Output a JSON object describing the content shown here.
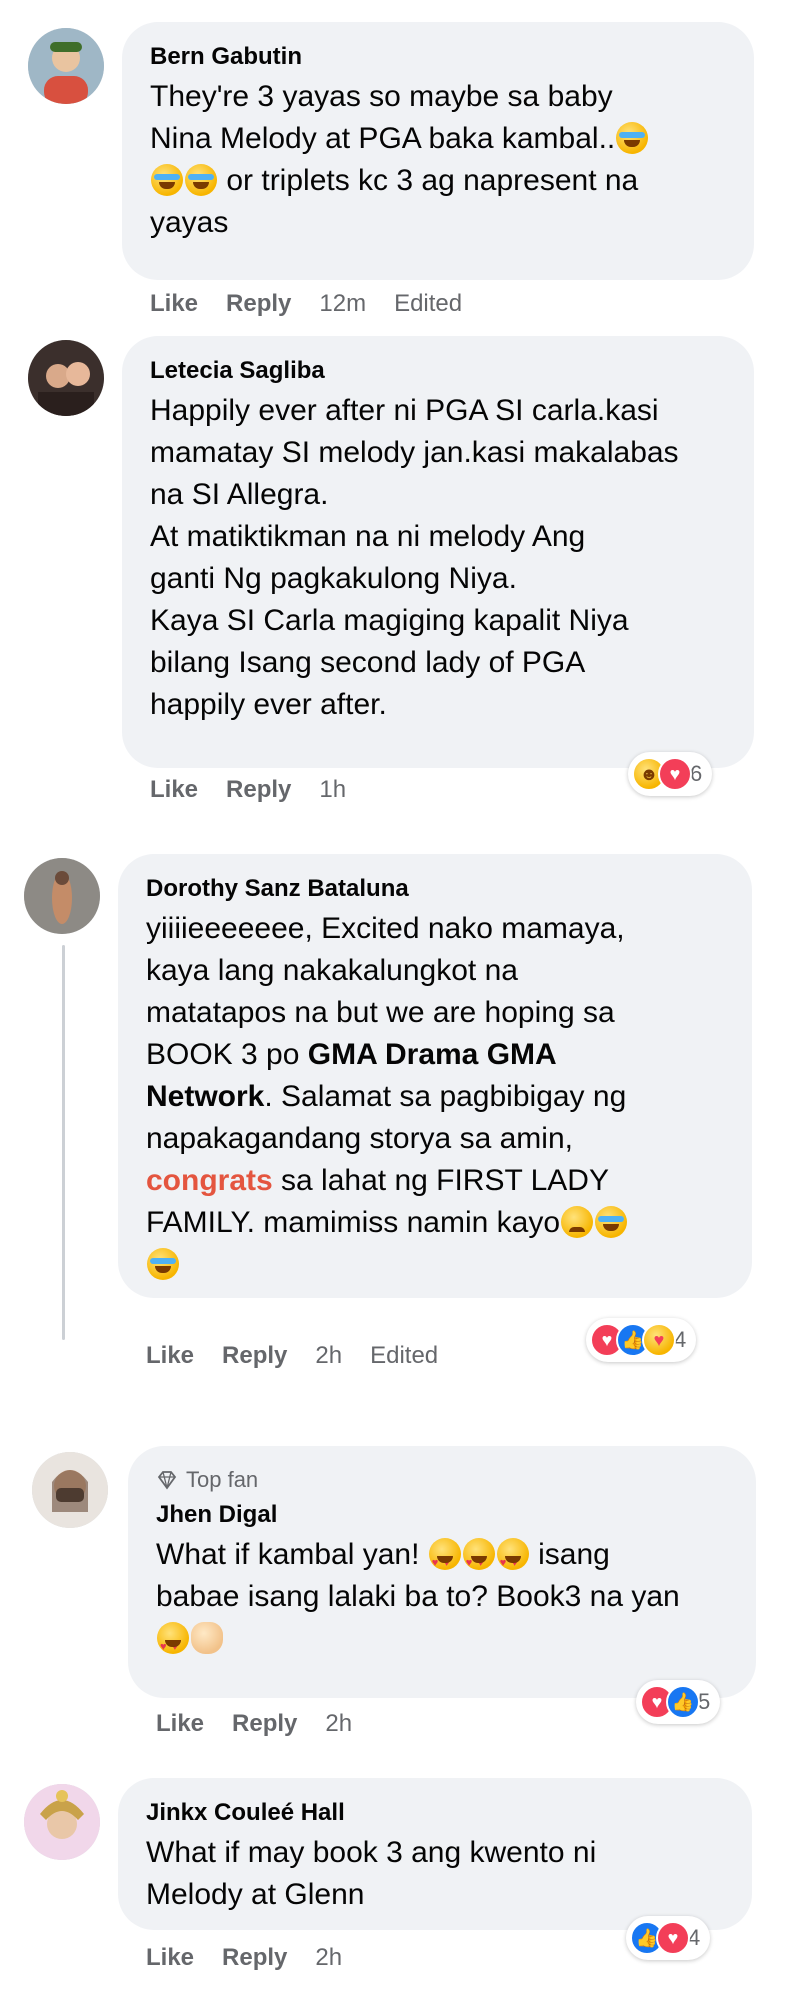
{
  "accent": "#e4553f",
  "comments": [
    {
      "author": "Bern Gabutin",
      "lines": [
        "They're 3 yayas so maybe sa baby",
        "Nina Melody at PGA baka kambal..",
        "or triplets kc 3 ag napresent na",
        "yayas"
      ],
      "emoji_names": [
        "tears-of-joy-emoji",
        "tears-of-joy-emoji",
        "tears-of-joy-emoji"
      ],
      "like": "Like",
      "reply": "Reply",
      "time": "12m",
      "edited": "Edited"
    },
    {
      "author": "Letecia Sagliba",
      "lines": [
        "Happily ever after ni PGA SI carla.kasi",
        "mamatay SI melody jan.kasi makalabas",
        "na SI Allegra.",
        "At matiktikman na ni melody Ang",
        "ganti Ng pagkakulong Niya.",
        "Kaya SI Carla magiging kapalit Niya",
        "bilang Isang second lady of PGA",
        "happily ever after."
      ],
      "reactions": [
        "haha",
        "love"
      ],
      "reaction_count": "6",
      "like": "Like",
      "reply": "Reply",
      "time": "1h"
    },
    {
      "author": "Dorothy Sanz Bataluna",
      "lines": [
        "yiiiieeeeeee, Excited nako mamaya,",
        "kaya lang nakakalungkot na",
        "matatapos na but we are hoping sa",
        "BOOK 3 po"
      ],
      "tag1": "GMA Drama GMA",
      "tag2": "Network",
      "after_tag": ". Salamat sa pagbibigay ng",
      "line6": "napakagandang storya sa amin,",
      "hashtag": "congrats",
      "after_hashtag": " sa lahat ng FIRST LADY",
      "line8": "FAMILY. mamimiss namin kayo",
      "reactions": [
        "love",
        "like",
        "care"
      ],
      "reaction_count": "4",
      "like": "Like",
      "reply": "Reply",
      "time": "2h",
      "edited": "Edited"
    },
    {
      "badge": "Top fan",
      "author": "Jhen Digal",
      "line1": "What if kambal yan!",
      "line1_after": " isang",
      "line2": "babae isang lalaki ba to? Book3 na yan",
      "reactions": [
        "love",
        "like"
      ],
      "reaction_count": "5",
      "like": "Like",
      "reply": "Reply",
      "time": "2h"
    },
    {
      "author": "Jinkx Couleé Hall",
      "lines": [
        "What if may book 3 ang kwento ni",
        "Melody at Glenn"
      ],
      "reactions": [
        "like",
        "love"
      ],
      "reaction_count": "4",
      "like": "Like",
      "reply": "Reply",
      "time": "2h"
    }
  ]
}
